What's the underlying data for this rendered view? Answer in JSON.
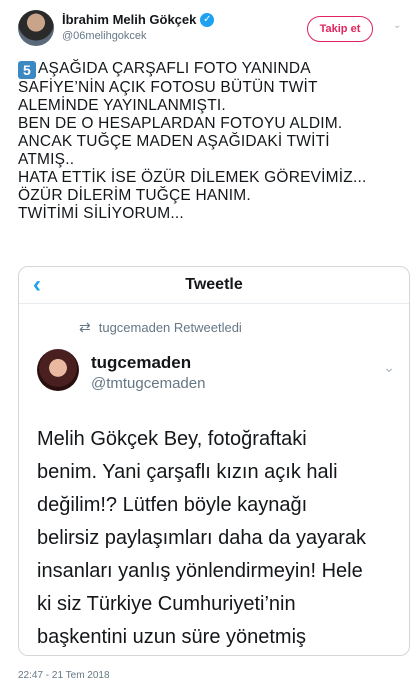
{
  "header": {
    "name": "İbrahim Melih Gökçek",
    "handle": "@06melihgokcek",
    "follow_label": "Takip et"
  },
  "tweet": {
    "badge": "5",
    "lines": [
      "AŞAĞIDA ÇARŞAFLI FOTO YANINDA",
      "SAFİYE’NİN AÇIK FOTOSU BÜTÜN TWİT",
      "ALEMİNDE YAYINLANMIŞTI.",
      "BEN DE O HESAPLARDAN FOTOYU ALDIM.",
      "ANCAK TUĞÇE MADEN AŞAĞIDAKİ TWİTİ",
      "ATMIŞ..",
      "HATA ETTİK İSE ÖZÜR DİLEMEK GÖREVİMİZ...",
      "ÖZÜR DİLERİM TUĞÇE HANIM.",
      "TWİTİMİ SİLİYORUM..."
    ]
  },
  "embed": {
    "title": "Tweetle",
    "retweet_label": "tugcemaden Retweetledi",
    "inner_name": "tugcemaden",
    "inner_handle": "@tmtugcemaden",
    "lines": [
      "Melih Gökçek Bey, fotoğraftaki",
      "benim. Yani çarşaflı kızın açık hali",
      "değilim!? Lütfen böyle kaynağı",
      "belirsiz paylaşımları daha da yayarak",
      "insanları yanlış yönlendirmeyin! Hele",
      "ki siz Türkiye Cumhuriyeti’nin",
      "başkentini uzun süre yönetmiş"
    ]
  },
  "timestamp": "22:47 - 21 Tem 2018",
  "icons": {
    "verified": "verified-badge-icon",
    "caret": "chevron-down-icon",
    "back": "chevron-left-icon",
    "retweet": "retweet-icon"
  },
  "colors": {
    "accent": "#1da1f2",
    "follow": "#e0245e",
    "muted": "#657786"
  }
}
